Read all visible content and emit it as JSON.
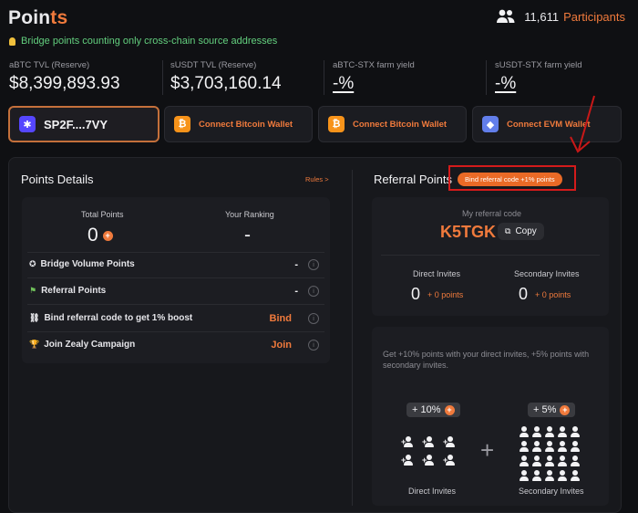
{
  "header": {
    "title_main": "Poin",
    "title_accent": "ts",
    "participants_count": "11,611",
    "participants_label": "Participants",
    "notice": "Bridge points counting only cross-chain source addresses"
  },
  "stats": [
    {
      "label": "aBTC TVL (Reserve)",
      "value": "$8,399,893.93"
    },
    {
      "label": "sUSDT TVL (Reserve)",
      "value": "$3,703,160.14"
    },
    {
      "label": "aBTC-STX farm yield",
      "value": "-%"
    },
    {
      "label": "sUSDT-STX farm yield",
      "value": "-%"
    }
  ],
  "wallets": {
    "stacks_address": "SP2F....7VY",
    "bitcoin_1": "Connect Bitcoin Wallet",
    "bitcoin_2": "Connect Bitcoin Wallet",
    "evm": "Connect EVM Wallet"
  },
  "points_details": {
    "heading": "Points Details",
    "rules": "Rules >",
    "total_label": "Total Points",
    "total_value": "0",
    "ranking_label": "Your Ranking",
    "ranking_value": "-",
    "rows": [
      {
        "label": "Bridge Volume Points",
        "value": "-",
        "icon": "medal-icon"
      },
      {
        "label": "Referral Points",
        "value": "-",
        "icon": "flag-icon"
      },
      {
        "label": "Bind referral code to get 1% boost",
        "value": "Bind",
        "icon": "link-icon"
      },
      {
        "label": "Join Zealy Campaign",
        "value": "Join",
        "icon": "trophy-icon"
      }
    ]
  },
  "referral": {
    "heading": "Referral Points",
    "bind_badge": "Bind referral code +1% points",
    "code_label": "My referral code",
    "code": "K5TGK",
    "copy": "Copy",
    "direct_label": "Direct Invites",
    "direct_value": "0",
    "direct_bonus": "+ 0 points",
    "secondary_label": "Secondary Invites",
    "secondary_value": "0",
    "secondary_bonus": "+ 0 points",
    "info_text": "Get +10% points with your direct invites, +5% points with secondary invites.",
    "direct_pct": "+ 10%",
    "secondary_pct": "+ 5%",
    "direct_caption": "Direct Invites",
    "secondary_caption": "Secondary Invites"
  },
  "colors": {
    "accent": "#f07a3c",
    "notice_green": "#63cf7e",
    "annotation_red": "#d41b1b"
  }
}
